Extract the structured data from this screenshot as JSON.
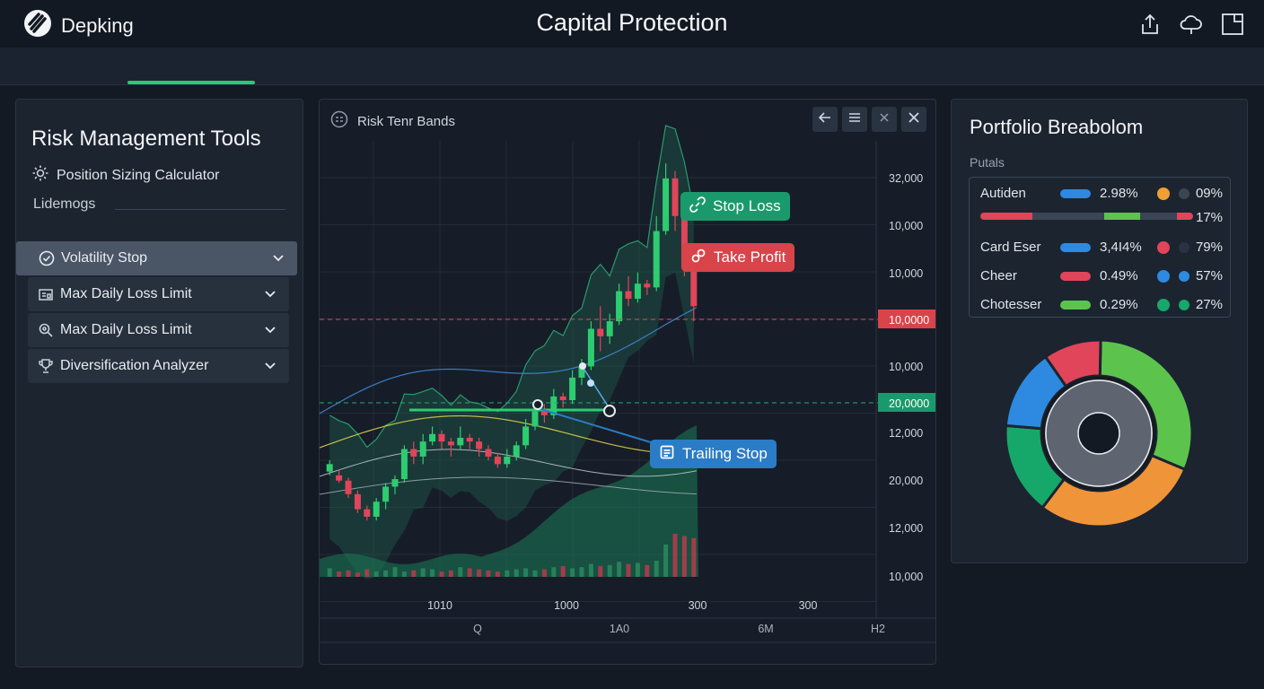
{
  "app": {
    "brand": "Depking",
    "title": "Capital Protection"
  },
  "left_panel": {
    "title": "Risk Management Tools",
    "subtitle": "Position Sizing Calculator",
    "section_label": "Lidemogs",
    "items": [
      {
        "label": "Volatility Stop",
        "icon": "check-circle-icon",
        "active": true
      },
      {
        "label": "Max Daily Loss Limit",
        "icon": "calculator-icon",
        "active": false
      },
      {
        "label": "Max Daily Loss Limit",
        "icon": "magnifier-icon",
        "active": false
      },
      {
        "label": "Diversification Analyzer",
        "icon": "trophy-icon",
        "active": false
      }
    ]
  },
  "chart_panel": {
    "title": "Risk Tenr Bands",
    "buttons": [
      "back-arrow",
      "menu",
      "close-small",
      "close"
    ],
    "callouts": {
      "stop_loss": "Stop Loss",
      "take_profit": "Take Profit",
      "trailing_stop": "Trailing Stop"
    },
    "y_ticks": [
      "32,000",
      "10,000",
      "10,000",
      "10,0000",
      "10,000",
      "20,0000",
      "12,000",
      "20,000",
      "12,000",
      "10,000"
    ],
    "x_ticks": [
      "1010",
      "1000",
      "300",
      "300"
    ],
    "x_ticks_2": [
      "Q",
      "1A0",
      "6M",
      "H2"
    ],
    "colors": {
      "up": "#2ecc71",
      "down": "#e0455a",
      "band": "#1f6e52",
      "stop_line": "#e0455a",
      "trail_line": "#2ecc71"
    }
  },
  "chart_data": {
    "type": "line",
    "title": "Risk Tenr Bands",
    "candles": [
      {
        "o": 460,
        "c": 470,
        "h": 475,
        "l": 455
      },
      {
        "o": 455,
        "c": 448,
        "h": 462,
        "l": 445
      },
      {
        "o": 448,
        "c": 430,
        "h": 452,
        "l": 425
      },
      {
        "o": 430,
        "c": 410,
        "h": 435,
        "l": 405
      },
      {
        "o": 410,
        "c": 400,
        "h": 415,
        "l": 395
      },
      {
        "o": 400,
        "c": 420,
        "h": 425,
        "l": 395
      },
      {
        "o": 420,
        "c": 440,
        "h": 445,
        "l": 410
      },
      {
        "o": 440,
        "c": 450,
        "h": 455,
        "l": 430
      },
      {
        "o": 450,
        "c": 490,
        "h": 495,
        "l": 445
      },
      {
        "o": 490,
        "c": 480,
        "h": 500,
        "l": 470
      },
      {
        "o": 480,
        "c": 500,
        "h": 510,
        "l": 470
      },
      {
        "o": 500,
        "c": 510,
        "h": 520,
        "l": 495
      },
      {
        "o": 510,
        "c": 500,
        "h": 515,
        "l": 490
      },
      {
        "o": 500,
        "c": 495,
        "h": 505,
        "l": 480
      },
      {
        "o": 495,
        "c": 505,
        "h": 520,
        "l": 490
      },
      {
        "o": 505,
        "c": 500,
        "h": 510,
        "l": 490
      },
      {
        "o": 500,
        "c": 490,
        "h": 505,
        "l": 480
      },
      {
        "o": 490,
        "c": 480,
        "h": 495,
        "l": 475
      },
      {
        "o": 480,
        "c": 470,
        "h": 485,
        "l": 465
      },
      {
        "o": 470,
        "c": 480,
        "h": 490,
        "l": 465
      },
      {
        "o": 480,
        "c": 495,
        "h": 500,
        "l": 475
      },
      {
        "o": 495,
        "c": 520,
        "h": 530,
        "l": 490
      },
      {
        "o": 520,
        "c": 540,
        "h": 545,
        "l": 515
      },
      {
        "o": 540,
        "c": 535,
        "h": 550,
        "l": 525
      },
      {
        "o": 535,
        "c": 560,
        "h": 570,
        "l": 530
      },
      {
        "o": 560,
        "c": 555,
        "h": 565,
        "l": 545
      },
      {
        "o": 555,
        "c": 585,
        "h": 595,
        "l": 550
      },
      {
        "o": 585,
        "c": 600,
        "h": 610,
        "l": 575
      },
      {
        "o": 600,
        "c": 650,
        "h": 660,
        "l": 595
      },
      {
        "o": 650,
        "c": 640,
        "h": 680,
        "l": 620
      },
      {
        "o": 640,
        "c": 660,
        "h": 670,
        "l": 630
      },
      {
        "o": 660,
        "c": 700,
        "h": 710,
        "l": 655
      },
      {
        "o": 700,
        "c": 690,
        "h": 720,
        "l": 680
      },
      {
        "o": 690,
        "c": 710,
        "h": 725,
        "l": 685
      },
      {
        "o": 710,
        "c": 705,
        "h": 715,
        "l": 695
      },
      {
        "o": 705,
        "c": 780,
        "h": 800,
        "l": 700
      },
      {
        "o": 780,
        "c": 850,
        "h": 870,
        "l": 775
      },
      {
        "o": 850,
        "c": 800,
        "h": 860,
        "l": 780
      },
      {
        "o": 800,
        "c": 730,
        "h": 810,
        "l": 720
      },
      {
        "o": 730,
        "c": 680,
        "h": 740,
        "l": 660
      }
    ],
    "volume": [
      8,
      5,
      6,
      4,
      7,
      5,
      6,
      9,
      5,
      6,
      8,
      7,
      5,
      6,
      9,
      8,
      7,
      6,
      5,
      6,
      7,
      8,
      6,
      7,
      9,
      10,
      8,
      9,
      12,
      10,
      11,
      14,
      12,
      13,
      11,
      15,
      30,
      40,
      38,
      36
    ],
    "stop_level": 720,
    "trail_level": 470
  },
  "right_panel": {
    "title": "Portfolio Breabolom",
    "label": "Putals",
    "rows": [
      {
        "name": "Autiden",
        "pill": "#2d8ae0",
        "pct": "2.98%",
        "dot1": "#f0a030",
        "dot2": "#3a4656",
        "value": "09%"
      },
      {
        "name": "Card Eser",
        "pill": "#2d8ae0",
        "pct": "3,4I4%",
        "dot1": "#e0455a",
        "dot2": "#2a3341",
        "value": "79%"
      },
      {
        "name": "Cheer",
        "pill": "#e0455a",
        "pct": "0.49%",
        "dot1": "#2d8ae0",
        "dot2": "#2d8ae0",
        "value": "57%"
      },
      {
        "name": "Chotesser",
        "pill": "#5cc44d",
        "pct": "0.29%",
        "dot1": "#16a86a",
        "dot2": "#16a86a",
        "value": "27%"
      }
    ],
    "bar_value": "17%",
    "donut": [
      {
        "name": "green",
        "value": 31,
        "color": "#5cc44d"
      },
      {
        "name": "orange",
        "value": 29,
        "color": "#f0943a"
      },
      {
        "name": "teal",
        "value": 16,
        "color": "#16a86a"
      },
      {
        "name": "blue",
        "value": 14,
        "color": "#2d8ae0"
      },
      {
        "name": "red",
        "value": 10,
        "color": "#e0455a"
      }
    ]
  }
}
